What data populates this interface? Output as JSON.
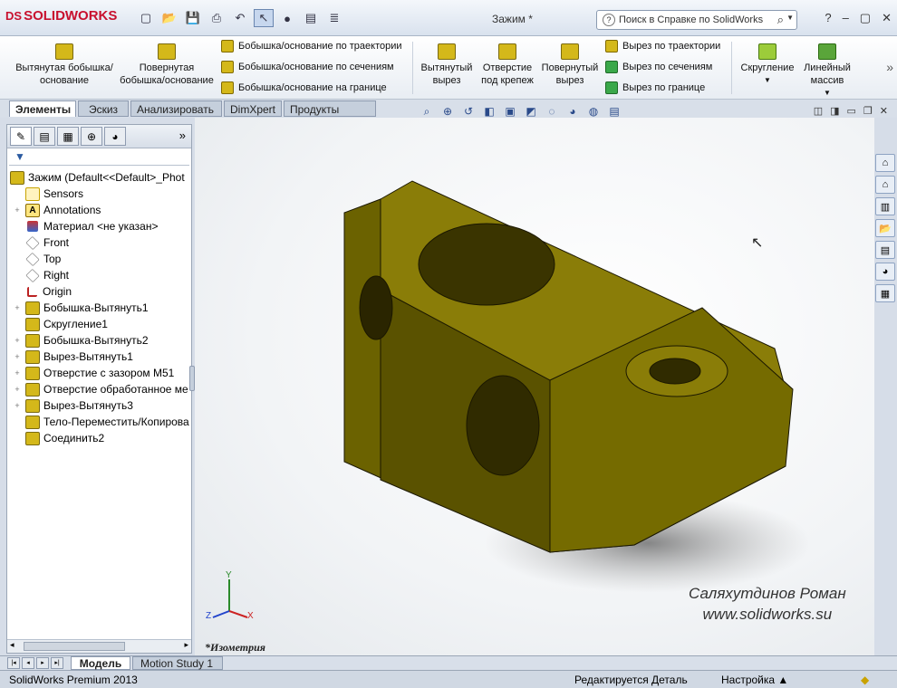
{
  "app": {
    "brand": "SOLIDWORKS",
    "document_title": "Зажим *"
  },
  "help_search": {
    "placeholder": "Поиск в Справке по SolidWorks"
  },
  "ribbon": {
    "extrude_boss": "Вытянутая бобышка/основание",
    "revolve_boss": "Повернутая бобышка/основание",
    "swept_boss": "Бобышка/основание по траектории",
    "loft_boss": "Бобышка/основание по сечениям",
    "boundary_boss": "Бобышка/основание на границе",
    "extrude_cut": "Вытянутый вырез",
    "hole_wizard": "Отверстие под крепеж",
    "revolve_cut": "Повернутый вырез",
    "swept_cut": "Вырез по траектории",
    "loft_cut": "Вырез по сечениям",
    "boundary_cut": "Вырез по границе",
    "fillet": "Скругление",
    "linear_pattern": "Линейный массив"
  },
  "command_tabs": [
    "Элементы",
    "Эскиз",
    "Анализировать",
    "DimXpert",
    "Продукты Office"
  ],
  "tree": {
    "root": "Зажим  (Default<<Default>_Phot",
    "items": [
      {
        "label": "Sensors",
        "icon": "sensors-icon",
        "expandable": false
      },
      {
        "label": "Annotations",
        "icon": "annotations-icon",
        "expandable": true
      },
      {
        "label": "Материал <не указан>",
        "icon": "material-icon",
        "expandable": false
      },
      {
        "label": "Front",
        "icon": "plane-icon",
        "expandable": false
      },
      {
        "label": "Top",
        "icon": "plane-icon",
        "expandable": false
      },
      {
        "label": "Right",
        "icon": "plane-icon",
        "expandable": false
      },
      {
        "label": "Origin",
        "icon": "origin-icon",
        "expandable": false
      },
      {
        "label": "Бобышка-Вытянуть1",
        "icon": "extrude-feature-icon",
        "expandable": true
      },
      {
        "label": "Скругление1",
        "icon": "fillet-feature-icon",
        "expandable": false
      },
      {
        "label": "Бобышка-Вытянуть2",
        "icon": "extrude-feature-icon",
        "expandable": true
      },
      {
        "label": "Вырез-Вытянуть1",
        "icon": "cut-feature-icon",
        "expandable": true
      },
      {
        "label": "Отверстие с зазором M51",
        "icon": "hole-feature-icon",
        "expandable": true
      },
      {
        "label": "Отверстие обработанное ме",
        "icon": "hole-feature-icon",
        "expandable": true
      },
      {
        "label": "Вырез-Вытянуть3",
        "icon": "cut-feature-icon",
        "expandable": true
      },
      {
        "label": "Тело-Переместить/Копирова",
        "icon": "move-body-icon",
        "expandable": false
      },
      {
        "label": "Соединить2",
        "icon": "combine-feature-icon",
        "expandable": false
      }
    ]
  },
  "viewport": {
    "view_name": "*Изометрия",
    "watermark_line1": "Саляхутдинов Роман",
    "watermark_line2": "www.solidworks.su",
    "axis_x": "X",
    "axis_y": "Y",
    "axis_z": "Z",
    "model_color": "#6b6200"
  },
  "bottom_tabs": [
    "Модель",
    "Motion Study 1"
  ],
  "status": {
    "product": "SolidWorks Premium 2013",
    "mode": "Редактируется Деталь",
    "settings": "Настройка"
  }
}
